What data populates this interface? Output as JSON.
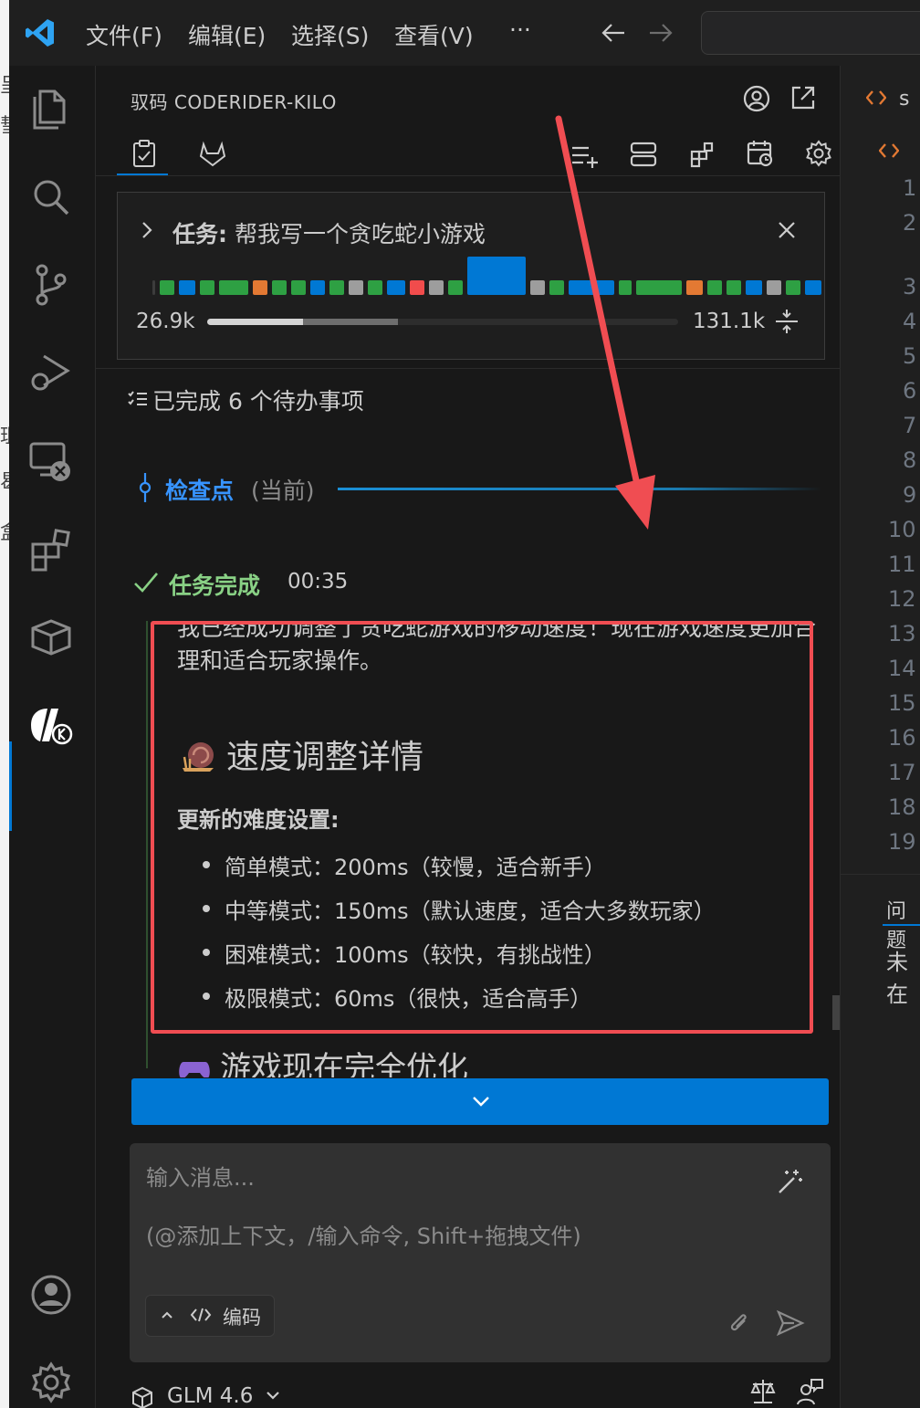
{
  "menu": {
    "file": "文件(F)",
    "edit": "编辑(E)",
    "select": "选择(S)",
    "view": "查看(V)",
    "more": "···"
  },
  "panel": {
    "title": "驭码 CODERIDER-KILO"
  },
  "task": {
    "prefix": "任务:",
    "text": " 帮我写一个贪吃蛇小游戏",
    "tokens_left": "26.9k",
    "tokens_right": "131.1k"
  },
  "todo": {
    "label": "已完成 6 个待办事项"
  },
  "checkpoint": {
    "label": "检查点",
    "current": "(当前)"
  },
  "completion": {
    "label": "任务完成",
    "time": "00:35",
    "paragraph": "我已经成功调整了贪吃蛇游戏的移动速度！现在游戏速度更加合理和适合玩家操作。",
    "heading": "速度调整详情",
    "subheading": "更新的难度设置:",
    "items": [
      "简单模式：200ms（较慢，适合新手）",
      "中等模式：150ms（默认速度，适合大多数玩家）",
      "困难模式：100ms（较快，有挑战性）",
      "极限模式：60ms（很快，适合高手）"
    ],
    "next_heading": "游戏现在完全优化"
  },
  "input": {
    "placeholder": "输入消息...",
    "hint": "(@添加上下文，/输入命令, Shift+拖拽文件)",
    "mode": "编码"
  },
  "model": {
    "name": "GLM 4.6"
  },
  "editor": {
    "tab": "s",
    "problems_tab": "问题",
    "problems_text": "未在",
    "line_numbers": [
      "1",
      "2",
      "3",
      "4",
      "5",
      "6",
      "7",
      "8",
      "9",
      "10",
      "11",
      "12",
      "13",
      "14",
      "15",
      "16",
      "17",
      "18",
      "19"
    ]
  },
  "colors": {
    "accent": "#0078d4",
    "success": "#89d185",
    "checkpoint": "#3794ff",
    "highlight": "#f04d52"
  }
}
